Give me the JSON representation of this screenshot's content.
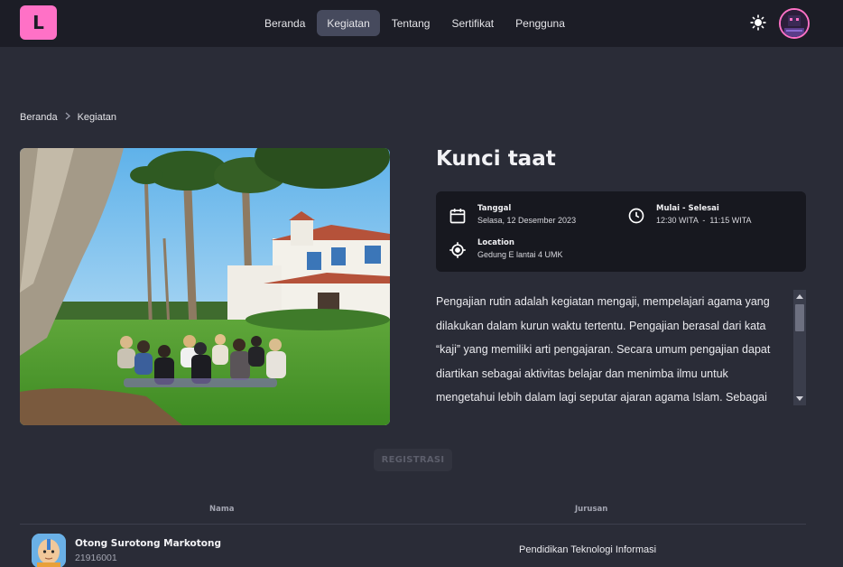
{
  "app": {
    "logo_letter": "L"
  },
  "nav": {
    "items": [
      {
        "label": "Beranda"
      },
      {
        "label": "Kegiatan"
      },
      {
        "label": "Tentang"
      },
      {
        "label": "Sertifikat"
      },
      {
        "label": "Pengguna"
      }
    ],
    "active": "Kegiatan"
  },
  "breadcrumb": {
    "items": [
      "Beranda",
      "Kegiatan"
    ]
  },
  "event": {
    "title": "Kunci taat",
    "date_label": "Tanggal",
    "date_value": "Selasa, 12 Desember 2023",
    "time_label": "Mulai - Selesai",
    "time_value": "12:30 WITA  -  11:15 WITA",
    "location_label": "Location",
    "location_value": "Gedung E lantai 4 UMK",
    "description": "Pengajian rutin adalah kegiatan mengaji, mempelajari agama yang dilakukan dalam kurun waktu tertentu. Pengajian berasal dari kata “kaji” yang memiliki arti pengajaran. Secara umum pengajian dapat diartikan sebagai aktivitas belajar dan menimba ilmu untuk mengetahui lebih dalam lagi seputar ajaran agama Islam. Sebagai"
  },
  "registration": {
    "button_label": "REGISTRASI"
  },
  "participants": {
    "columns": [
      "Nama",
      "Jurusan"
    ],
    "rows": [
      {
        "name": "Otong Surotong Markotong",
        "id": "21916001",
        "department": "Pendidikan Teknologi Informasi"
      }
    ]
  },
  "colors": {
    "accent": "#ff71c6",
    "navbar_bg": "#1c1d26",
    "page_bg": "#2a2c37",
    "card_bg": "#17181f"
  }
}
